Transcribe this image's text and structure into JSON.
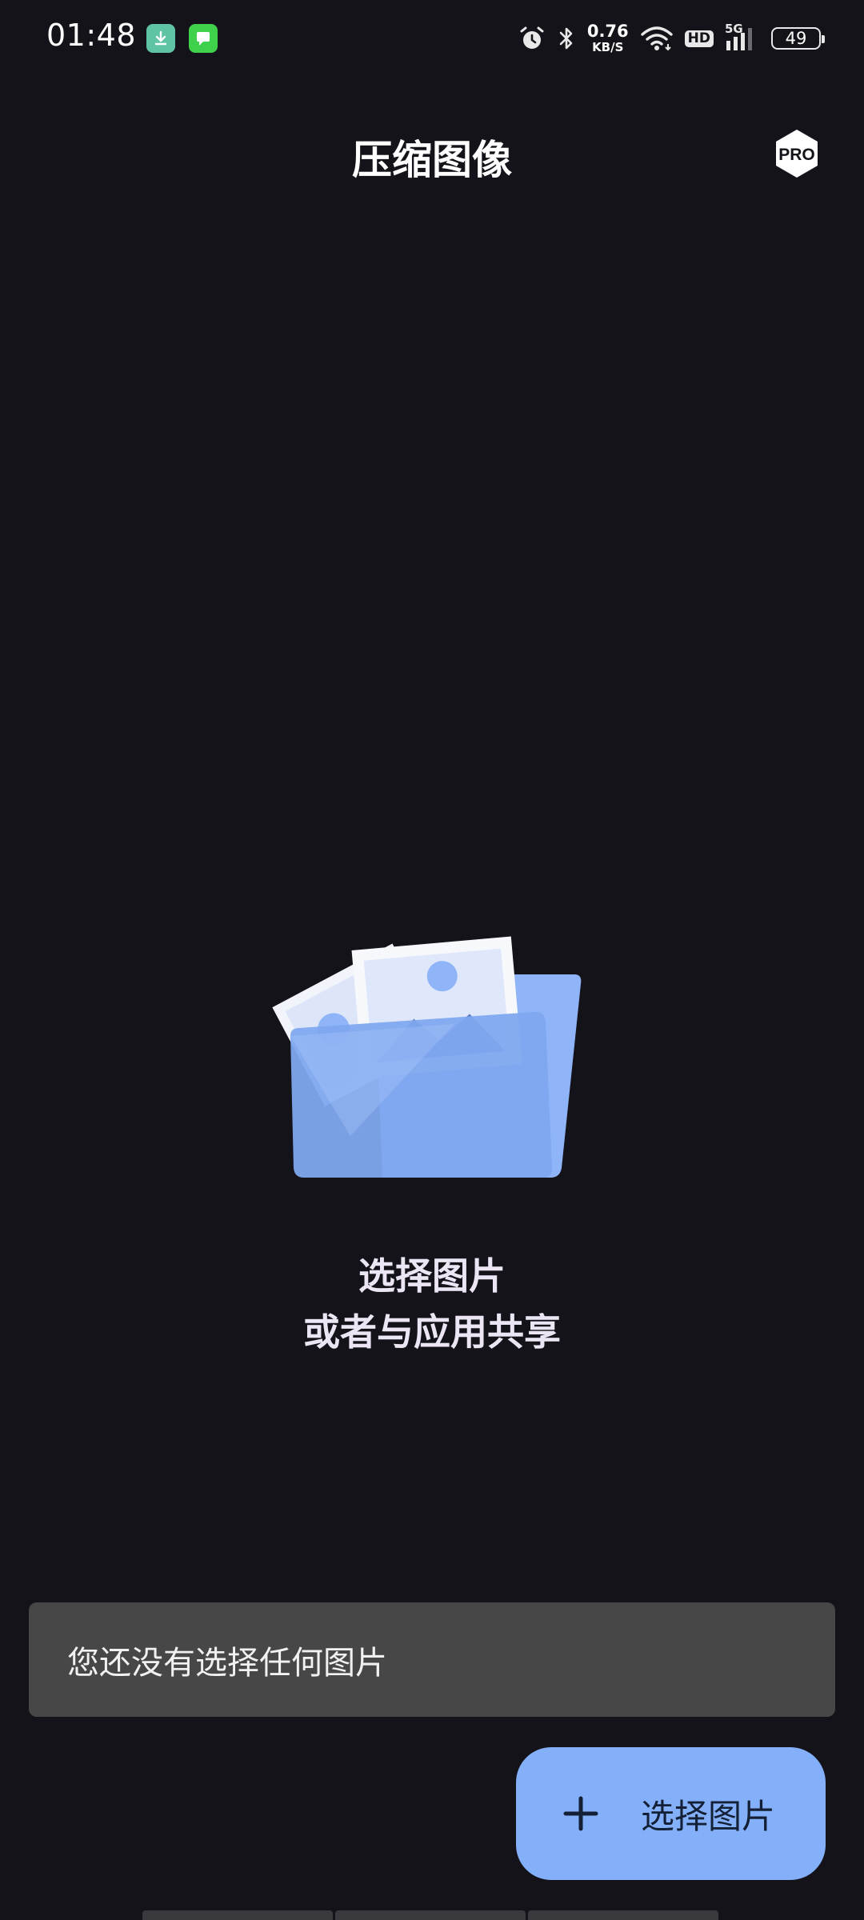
{
  "status_bar": {
    "time": "01:48",
    "net_speed_value": "0.76",
    "net_speed_unit": "KB/S",
    "hd_label": "HD",
    "network_label": "5G",
    "battery_level": "49",
    "icons": [
      "download-notification-icon",
      "message-notification-icon",
      "alarm-icon",
      "bluetooth-icon",
      "wifi-icon",
      "signal-icon",
      "battery-icon"
    ]
  },
  "app_bar": {
    "title": "压缩图像",
    "pro_label": "PRO"
  },
  "empty_state": {
    "line1": "选择图片",
    "line2": "或者与应用共享"
  },
  "snackbar": {
    "message": "您还没有选择任何图片"
  },
  "fab": {
    "label": "选择图片",
    "icon": "plus-icon"
  },
  "colors": {
    "background": "#15131a",
    "accent": "#84b0fa",
    "snackbar": "#474747"
  }
}
